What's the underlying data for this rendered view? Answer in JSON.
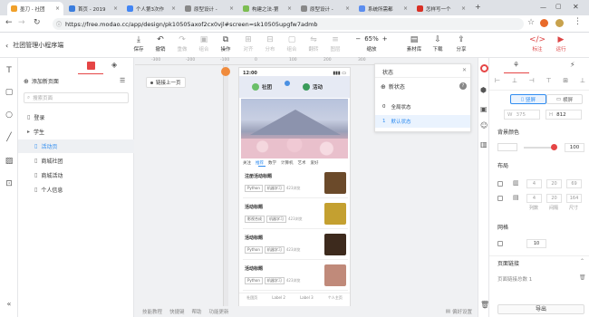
{
  "browser": {
    "tabs": [
      {
        "label": "墨刀 - 社团",
        "color": "#f0a02a",
        "active": true
      },
      {
        "label": "首页 - 2019",
        "color": "#3b7ddd",
        "active": false
      },
      {
        "label": "个人第3次作",
        "color": "#4285f4",
        "active": false
      },
      {
        "label": "原型设计 - ",
        "color": "#888888",
        "active": false
      },
      {
        "label": "构建之法-第",
        "color": "#7cbd52",
        "active": false
      },
      {
        "label": "原型设计 - ",
        "color": "#888888",
        "active": false
      },
      {
        "label": "系统所需都",
        "color": "#5b8def",
        "active": false
      },
      {
        "label": "怎样写一个",
        "color": "#d93025",
        "active": false
      }
    ],
    "url": "https://free.modao.cc/app/design/pk10505axof2cx0vjl#screen=sk10505upgfw7admb"
  },
  "header": {
    "project_title": "社团管理小程序端",
    "tools": [
      {
        "label": "保存",
        "icon": "save-icon",
        "glyph": "⤓",
        "enabled": true
      },
      {
        "label": "撤销",
        "icon": "undo-icon",
        "glyph": "↶",
        "enabled": true
      },
      {
        "label": "重做",
        "icon": "redo-icon",
        "glyph": "↷",
        "enabled": false
      },
      {
        "label": "组合",
        "icon": "group-icon",
        "glyph": "▣",
        "enabled": false
      },
      {
        "label": "操作",
        "icon": "operate-icon",
        "glyph": "⧉",
        "enabled": true
      }
    ],
    "align_tools": [
      {
        "label": "对齐",
        "glyph": "⊞"
      },
      {
        "label": "分布",
        "glyph": "⊟"
      },
      {
        "label": "组合",
        "glyph": "▢"
      },
      {
        "label": "翻转",
        "glyph": "⇋"
      },
      {
        "label": "图层",
        "glyph": "≡"
      }
    ],
    "zoom": "65%",
    "zoom_label": "缩放",
    "right_tools": [
      {
        "label": "素材库",
        "glyph": "▤"
      },
      {
        "label": "下载",
        "glyph": "⇩"
      },
      {
        "label": "分享",
        "glyph": "⇪"
      }
    ],
    "far_tools": [
      {
        "label": "标注",
        "glyph": "</>",
        "color": "#d44"
      },
      {
        "label": "运行",
        "glyph": "▶",
        "color": "#d44"
      }
    ]
  },
  "pages_panel": {
    "add_page": "添加新页面",
    "search_placeholder": "搜索页面",
    "pages": [
      {
        "label": "登录",
        "indent": 0,
        "type": "page",
        "selected": false
      },
      {
        "label": "学生",
        "indent": 0,
        "type": "folder",
        "selected": false
      },
      {
        "label": "活动页",
        "indent": 1,
        "type": "page",
        "selected": true
      },
      {
        "label": "商城社团",
        "indent": 1,
        "type": "page",
        "selected": false
      },
      {
        "label": "商城活动",
        "indent": 1,
        "type": "page",
        "selected": false
      },
      {
        "label": "个人信息",
        "indent": 1,
        "type": "page",
        "selected": false
      }
    ]
  },
  "canvas": {
    "ruler_labels": [
      "-300",
      "-200",
      "-100",
      "0",
      "100",
      "200",
      "300"
    ],
    "link_back": "链接上一页",
    "phone": {
      "time": "12:00",
      "top_tabs": [
        "社团",
        "活动"
      ],
      "category_tabs": [
        "关注",
        "推荐",
        "数学",
        "计算机",
        "艺术",
        "爱好"
      ],
      "cards": [
        {
          "title": "注册活动标题",
          "tags": [
            "Python",
            "机器学习"
          ],
          "meta": "423浏览"
        },
        {
          "title": "活动标题",
          "tags": [
            "影视合成",
            "机器学习"
          ],
          "meta": "423浏览"
        },
        {
          "title": "活动标题",
          "tags": [
            "Python",
            "机器学习"
          ],
          "meta": "423浏览"
        },
        {
          "title": "活动标题",
          "tags": [
            "Python",
            "机器学习"
          ],
          "meta": "423浏览"
        }
      ],
      "bottom_tabs": [
        "社团页",
        "Label 2",
        "Label 3",
        "个人主页"
      ]
    }
  },
  "status_panel": {
    "title": "状态",
    "new_state": "新状态",
    "states": [
      {
        "index": "0",
        "label": "全局状态",
        "selected": false
      },
      {
        "index": "1",
        "label": "默认状态",
        "selected": true
      }
    ]
  },
  "right_panel": {
    "orientation": {
      "portrait": "竖屏",
      "landscape": "横屏"
    },
    "width": "375",
    "height": "812",
    "bg_color_label": "背景颜色",
    "opacity": "100",
    "layout_label": "布局",
    "layout_rows": [
      {
        "values": [
          "4",
          "20",
          "69"
        ],
        "captions": []
      },
      {
        "values": [
          "4",
          "20",
          "164"
        ],
        "captions": [
          "列数",
          "间隔",
          "尺寸"
        ]
      }
    ],
    "grid_label": "网格",
    "grid_value": "10",
    "page_link_label": "页面链接",
    "page_link_count": "页面链接总数 1",
    "export": "导出"
  },
  "bottom_bar": {
    "links": [
      "技能教程",
      "快捷键",
      "帮助",
      "功能更新"
    ],
    "settings": "偏好设置"
  },
  "colors": {
    "accent": "#2f8cf0",
    "danger": "#e54545",
    "sky": "#8a9ec6"
  }
}
